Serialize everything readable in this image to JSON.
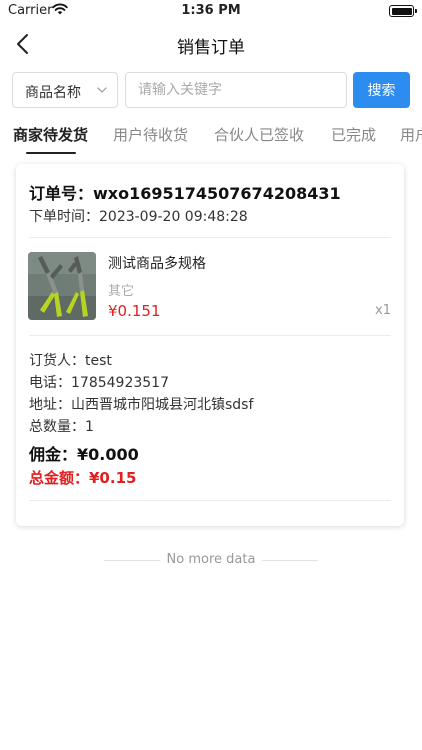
{
  "status_bar": {
    "carrier": "Carrier",
    "time": "1:36 PM",
    "icons": [
      "wifi-icon",
      "battery-icon"
    ]
  },
  "nav": {
    "title": "销售订单",
    "back_icon": "chevron-left-icon"
  },
  "search": {
    "category_value": "商品名称",
    "placeholder": "请输入关键字",
    "button_label": "搜索"
  },
  "tabs": [
    {
      "label": "商家待发货",
      "active": true
    },
    {
      "label": "用户待收货",
      "active": false
    },
    {
      "label": "合伙人已签收",
      "active": false
    },
    {
      "label": "已完成",
      "active": false
    },
    {
      "label": "用户",
      "active": false
    }
  ],
  "order": {
    "order_no": "订单号：wxo1695174507674208431",
    "order_time": "下单时间：2023-09-20 09:48:28",
    "product": {
      "name": "测试商品多规格",
      "spec": "其它",
      "price": "¥0.151",
      "qty": "x1"
    },
    "orderer": "订货人：test",
    "phone": "电话：17854923517",
    "address": "地址：山西晋城市阳城县河北镇sdsf",
    "total_qty": "总数量：1",
    "commission": "佣金：¥0.000",
    "total_amount": "总金额：¥0.15"
  },
  "footer": {
    "no_more_text": "No more data"
  },
  "colors": {
    "accent": "#2d8cf0",
    "price_red": "#e02020",
    "muted": "#999999"
  }
}
